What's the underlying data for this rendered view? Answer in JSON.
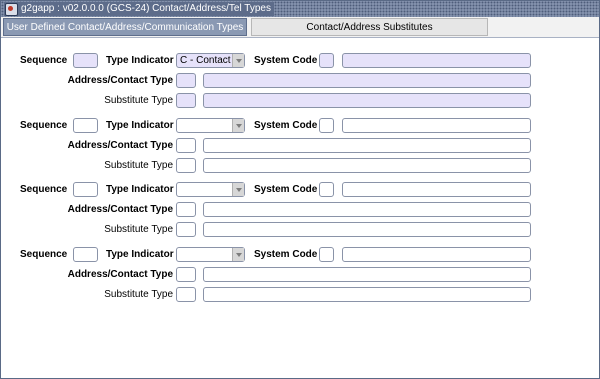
{
  "window": {
    "title": "g2gapp : v02.0.0.0 (GCS-24) Contact/Address/Tel Types"
  },
  "tabs": [
    {
      "label": "User Defined Contact/Address/Communication Types"
    },
    {
      "label": "Contact/Address Substitutes"
    }
  ],
  "labels": {
    "sequence": "Sequence",
    "type_indicator": "Type Indicator",
    "system_code": "System Code",
    "address_contact_type": "Address/Contact Type",
    "substitute_type": "Substitute Type"
  },
  "records": [
    {
      "sequence": "",
      "type_indicator": "C - Contact",
      "system_code": "",
      "system_code_desc": "",
      "address_contact_type": "",
      "address_contact_desc": "",
      "substitute_type": "",
      "substitute_desc": ""
    },
    {
      "sequence": "",
      "type_indicator": "",
      "system_code": "",
      "system_code_desc": "",
      "address_contact_type": "",
      "address_contact_desc": "",
      "substitute_type": "",
      "substitute_desc": ""
    },
    {
      "sequence": "",
      "type_indicator": "",
      "system_code": "",
      "system_code_desc": "",
      "address_contact_type": "",
      "address_contact_desc": "",
      "substitute_type": "",
      "substitute_desc": ""
    },
    {
      "sequence": "",
      "type_indicator": "",
      "system_code": "",
      "system_code_desc": "",
      "address_contact_type": "",
      "address_contact_desc": "",
      "substitute_type": "",
      "substitute_desc": ""
    }
  ],
  "colors": {
    "titlebar": "#5d6c8a",
    "active_tab": "#8a99b3",
    "field_tint": "#e6e2fa"
  },
  "icons": {
    "app": "app-icon",
    "dropdown": "chevron-down-icon"
  }
}
